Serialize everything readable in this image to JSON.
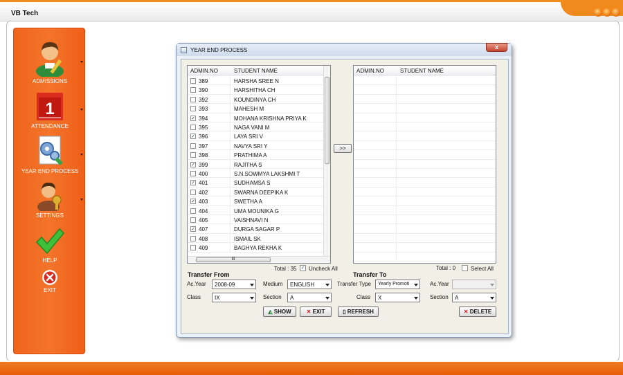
{
  "app": {
    "title": "VB Tech"
  },
  "sidebar": {
    "items": [
      {
        "label": "ADMISSIONS",
        "icon": "student-icon"
      },
      {
        "label": "ATTENDANCE",
        "icon": "calendar-icon",
        "calendar_day": "1"
      },
      {
        "label": "YEAR END PROCESS",
        "icon": "gears-document-icon"
      },
      {
        "label": "SETTINGS",
        "icon": "user-key-icon"
      },
      {
        "label": "HELP",
        "icon": "checkmark-icon"
      },
      {
        "label": "EXIT",
        "icon": "close-icon"
      }
    ]
  },
  "window": {
    "title": "YEAR END PROCESS",
    "close_glyph": "x"
  },
  "left_grid": {
    "headers": [
      "ADMIN.NO",
      "STUDENT NAME"
    ],
    "rows": [
      {
        "admin_no": "389",
        "name": "HARSHA SREE N",
        "checked": false
      },
      {
        "admin_no": "390",
        "name": "HARSHITHA  CH",
        "checked": false
      },
      {
        "admin_no": "392",
        "name": "KOUNDINYA CH",
        "checked": false
      },
      {
        "admin_no": "393",
        "name": "MAHESH M",
        "checked": false
      },
      {
        "admin_no": "394",
        "name": "MOHANA KRISHNA PRIYA K",
        "checked": true
      },
      {
        "admin_no": "395",
        "name": "NAGA VANI M",
        "checked": false
      },
      {
        "admin_no": "396",
        "name": "LAYA SRI V",
        "checked": true
      },
      {
        "admin_no": "397",
        "name": "NAVYA SRI Y",
        "checked": false
      },
      {
        "admin_no": "398",
        "name": "PRATHIMA A",
        "checked": false
      },
      {
        "admin_no": "399",
        "name": "RAJITHA S",
        "checked": true
      },
      {
        "admin_no": "400",
        "name": "S.N.SOWMYA LAKSHMI T",
        "checked": false
      },
      {
        "admin_no": "401",
        "name": "SUDHAMSA S",
        "checked": true
      },
      {
        "admin_no": "402",
        "name": "SWARNA DEEPIKA K",
        "checked": false
      },
      {
        "admin_no": "403",
        "name": "SWETHA  A",
        "checked": true
      },
      {
        "admin_no": "404",
        "name": "UMA MOUNIKA G",
        "checked": false
      },
      {
        "admin_no": "405",
        "name": "VAISHNAVI N",
        "checked": false
      },
      {
        "admin_no": "407",
        "name": "DURGA SAGAR  P",
        "checked": true
      },
      {
        "admin_no": "408",
        "name": "ISMAIL SK",
        "checked": false
      },
      {
        "admin_no": "409",
        "name": "BAGHYA REKHA K",
        "checked": false
      }
    ],
    "total": "Total : 35",
    "uncheck_all": "Uncheck All",
    "uncheck_all_checked": true,
    "hscroll_glyph": "III"
  },
  "right_grid": {
    "headers": [
      "ADMIN.NO",
      "STUDENT NAME"
    ],
    "total": "Total : 0",
    "select_all": "Select All",
    "select_all_checked": false
  },
  "move_button": ">>",
  "transfer_from": {
    "title": "Transfer From",
    "ac_year_label": "Ac.Year",
    "ac_year_value": "2008-09",
    "medium_label": "Medium",
    "medium_value": "ENGLISH",
    "class_label": "Class",
    "class_value": "IX",
    "section_label": "Section",
    "section_value": "A"
  },
  "transfer_to": {
    "title": "Transfer To",
    "transfer_type_label": "Transfer Type",
    "transfer_type_value": "Yearly Promoti",
    "ac_year_label": "Ac.Year",
    "ac_year_value": "",
    "class_label": "Class",
    "class_value": "X",
    "section_label": "Section",
    "section_value": "A"
  },
  "buttons": {
    "show": "SHOW",
    "exit": "EXIT",
    "refresh": "REFRESH",
    "delete": "DELETE"
  },
  "colors": {
    "accent": "#f07020",
    "sidebar": "#f36b22",
    "window_bg": "#f0f0e6"
  }
}
